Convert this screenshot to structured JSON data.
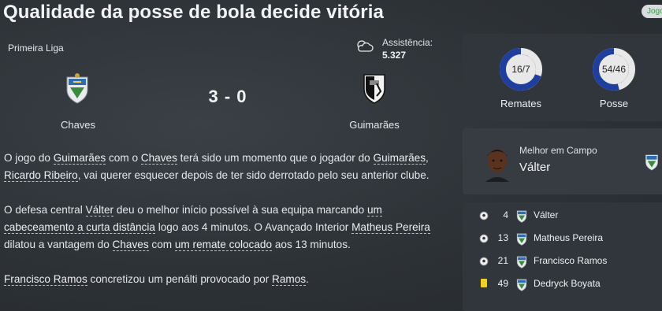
{
  "headline": "Qualidade da posse de bola decide vitória",
  "badge": "Jogo",
  "match": {
    "competition": "Primeira Liga",
    "home_team": "Chaves",
    "away_team": "Guimarães",
    "score": "3 - 0",
    "attendance_label": "Assistência:",
    "attendance_value": "5.327",
    "weather_icon": "cloudy-icon"
  },
  "article": {
    "paragraphs": [
      [
        {
          "t": "O jogo do "
        },
        {
          "t": "Guimarães",
          "link": true
        },
        {
          "t": " com o "
        },
        {
          "t": "Chaves",
          "link": true
        },
        {
          "t": " terá sido um momento que o jogador do "
        },
        {
          "t": "Guimarães",
          "link": true
        },
        {
          "t": ", "
        },
        {
          "t": "Ricardo Ribeiro",
          "link": true
        },
        {
          "t": ", vai querer esquecer depois de ter sido derrotado pelo seu anterior clube."
        }
      ],
      [
        {
          "t": "O defesa central "
        },
        {
          "t": "Válter",
          "link": true
        },
        {
          "t": " deu o melhor início possível à sua equipa marcando "
        },
        {
          "t": "um cabeceamento a curta distância",
          "link": true
        },
        {
          "t": " logo aos 4 minutos. O Avançado Interior "
        },
        {
          "t": "Matheus Pereira",
          "link": true
        },
        {
          "t": " dilatou a vantagem do "
        },
        {
          "t": "Chaves",
          "link": true
        },
        {
          "t": " com "
        },
        {
          "t": "um remate colocado",
          "link": true
        },
        {
          "t": " aos 13 minutos."
        }
      ],
      [
        {
          "t": "Francisco Ramos",
          "link": true
        },
        {
          "t": " concretizou um penálti provocado por "
        },
        {
          "t": "Ramos",
          "link": true
        },
        {
          "t": "."
        }
      ]
    ]
  },
  "stats": {
    "shots": {
      "label": "Remates",
      "value_text": "16/7",
      "home_share": 0.6957,
      "home_color": "#1f3fa0",
      "away_color": "#e8e8e8"
    },
    "possession": {
      "label": "Posse",
      "value_text": "54/46",
      "home_share": 0.54,
      "home_color": "#1f3fa0",
      "away_color": "#e8e8e8"
    }
  },
  "man_of_match": {
    "title": "Melhor em Campo",
    "name": "Válter"
  },
  "events": [
    {
      "type": "goal",
      "icon": "ball-icon",
      "minute": "4",
      "player": "Válter"
    },
    {
      "type": "goal",
      "icon": "ball-icon",
      "minute": "13",
      "player": "Matheus Pereira"
    },
    {
      "type": "goal",
      "icon": "ball-icon",
      "minute": "21",
      "player": "Francisco Ramos"
    },
    {
      "type": "yellow",
      "icon": "yellow-card-icon",
      "minute": "49",
      "player": "Dedryck Boyata"
    }
  ]
}
